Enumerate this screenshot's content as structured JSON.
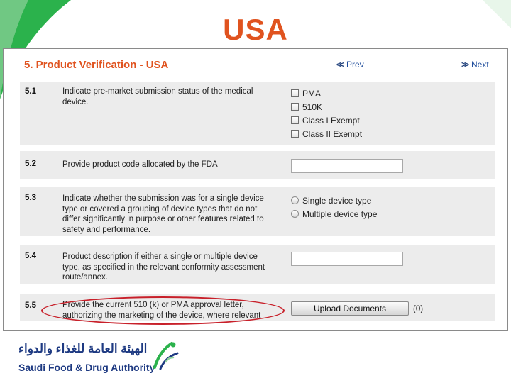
{
  "slide": {
    "title": "USA",
    "title_color": "#e0531f"
  },
  "panel": {
    "title": "5. Product Verification - USA",
    "prev_label": "Prev",
    "next_label": "Next"
  },
  "questions": [
    {
      "number": "5.1",
      "text": "Indicate pre-market submission status of the medical device.",
      "options": [
        "PMA",
        "510K",
        "Class I Exempt",
        "Class II Exempt"
      ]
    },
    {
      "number": "5.2",
      "text": "Provide product code allocated by the FDA",
      "input_value": ""
    },
    {
      "number": "5.3",
      "text": "Indicate whether the submission was for a single device type or covered a grouping of device types that do not differ significantly in purpose or other features related to safety and performance.",
      "options": [
        "Single device type",
        "Multiple device type"
      ]
    },
    {
      "number": "5.4",
      "text": "Product description if either a single or multiple device type, as specified in the relevant conformity assessment route/annex.",
      "input_value": ""
    },
    {
      "number": "5.5",
      "text": "Provide the current 510 (k) or PMA approval letter, authorizing the marketing of the device, where relevant",
      "button_label": "Upload Documents",
      "count": "(0)"
    }
  ],
  "footer": {
    "logo_arabic": "الهيئة العامة للغذاء والدواء",
    "logo_english": "Saudi Food & Drug Authority"
  },
  "colors": {
    "accent": "#e0531f",
    "link": "#1f4d9c",
    "row_bg": "#ececec",
    "highlight": "#c8202a",
    "brand_green": "#2bb24c",
    "brand_blue": "#1e3a82"
  }
}
